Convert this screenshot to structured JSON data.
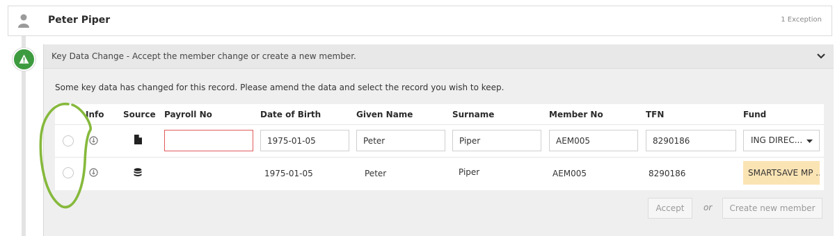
{
  "header": {
    "name": "Peter Piper",
    "exceptions": "1 Exception"
  },
  "panel": {
    "title": "Key Data Change - Accept the member change or create a new member.",
    "instructions": "Some key data has changed for this record. Please amend the data and select the record you wish to keep."
  },
  "table": {
    "columns": [
      "Info",
      "Source",
      "Payroll No",
      "Date of Birth",
      "Given Name",
      "Surname",
      "Member No",
      "TFN",
      "Fund"
    ],
    "rows": [
      {
        "source_icon": "document-icon",
        "payroll_no": "",
        "dob": "1975-01-05",
        "given_name": "Peter",
        "surname": "Piper",
        "member_no": "AEM005",
        "tfn": "8290186",
        "fund": "ING DIREC..."
      },
      {
        "source_icon": "database-icon",
        "payroll_no": "",
        "dob": "1975-01-05",
        "given_name": "Peter",
        "surname": "Piper",
        "member_no": "AEM005",
        "tfn": "8290186",
        "fund": "SMARTSAVE MP ..."
      }
    ]
  },
  "actions": {
    "accept": "Accept",
    "or": "or",
    "create_new": "Create new member"
  },
  "colors": {
    "accent_green": "#3d9b3f",
    "error_border": "#e05a5a",
    "fund_highlight": "#fbe4b4"
  }
}
